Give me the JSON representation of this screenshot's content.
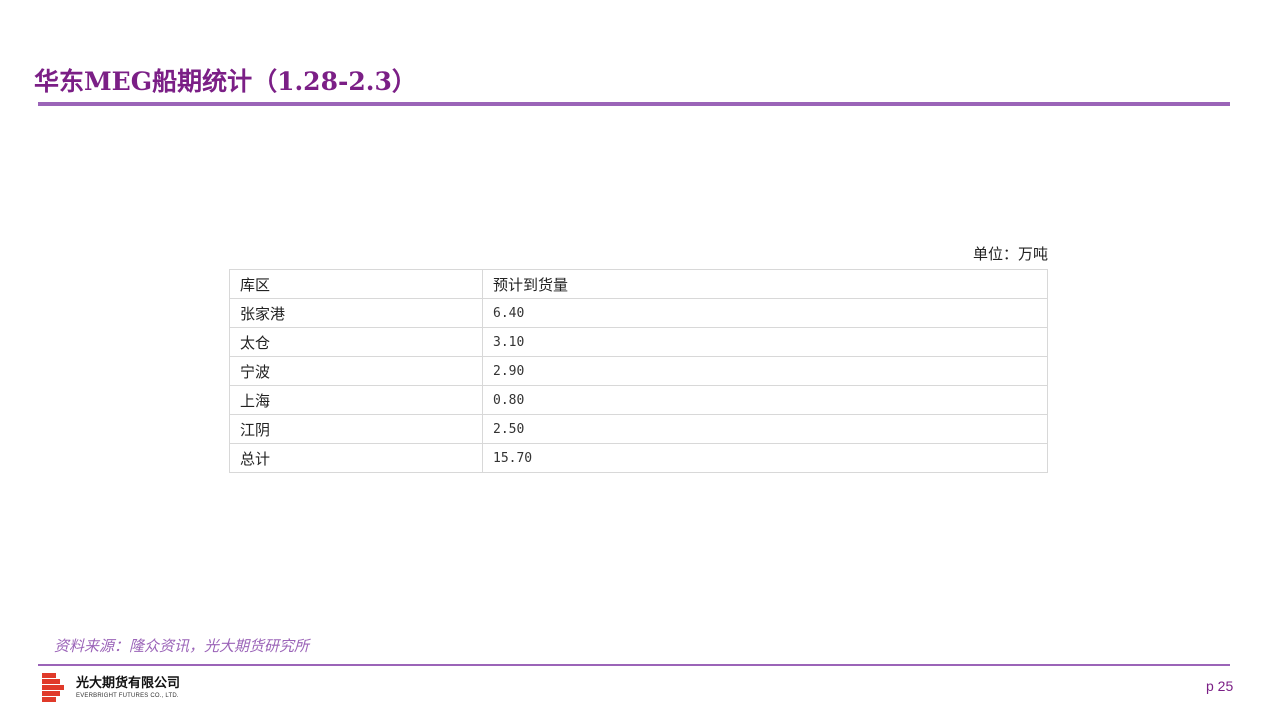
{
  "title": "华东MEG船期统计（1.28-2.3）",
  "unit": "单位：万吨",
  "table": {
    "headers": [
      "库区",
      "预计到货量"
    ],
    "rows": [
      [
        "张家港",
        "6.40"
      ],
      [
        "太仓",
        "3.10"
      ],
      [
        "宁波",
        "2.90"
      ],
      [
        "上海",
        "0.80"
      ],
      [
        "江阴",
        "2.50"
      ],
      [
        "总计",
        "15.70"
      ]
    ]
  },
  "source": "资料来源：隆众资讯，光大期货研究所",
  "footer": {
    "logo_cn": "光大期货有限公司",
    "logo_en": "EVERBRIGHT FUTURES CO., LTD.",
    "page": "p 25"
  },
  "colors": {
    "accent": "#7b1f86",
    "rule": "#9b64b8",
    "logo": "#e03a2a"
  },
  "icons": {
    "logo": "everbright-logo-icon"
  }
}
